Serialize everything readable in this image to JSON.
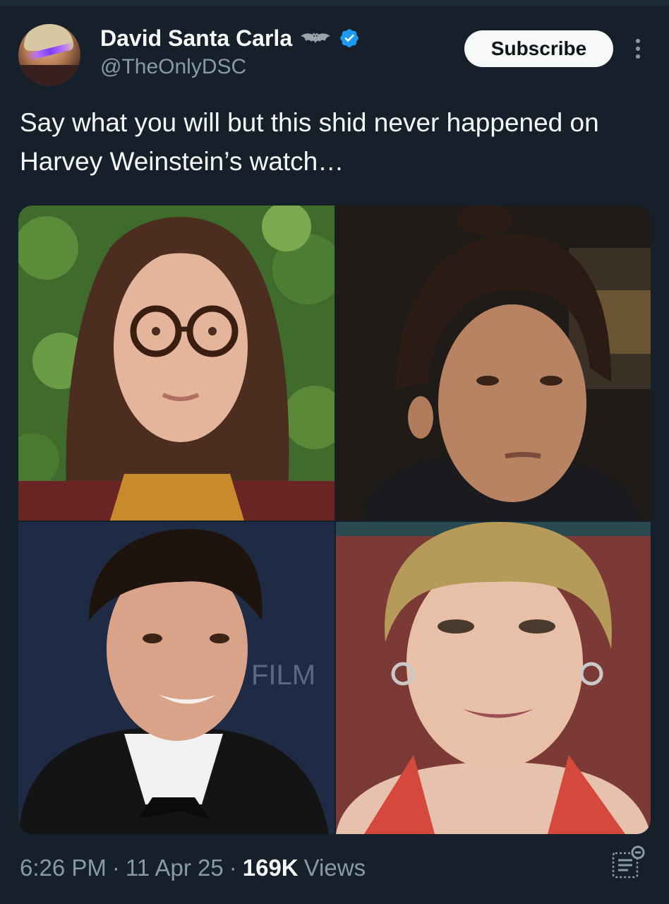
{
  "author": {
    "display_name": "David Santa Carla",
    "handle": "@TheOnlyDSC",
    "badge_icon": "bat-icon",
    "verified_icon": "verified-badge-icon",
    "verified_color": "#1d9bf0"
  },
  "header": {
    "subscribe_label": "Subscribe",
    "more_icon": "more-vertical-icon"
  },
  "tweet": {
    "text": "Say what you will but this shid never happened on Harvey Weinstein’s watch…"
  },
  "media": {
    "photos": [
      {
        "icon": "portrait-photo"
      },
      {
        "icon": "portrait-photo"
      },
      {
        "icon": "portrait-photo",
        "backdrop_text": "FILM"
      },
      {
        "icon": "portrait-photo"
      }
    ]
  },
  "footer": {
    "time": "6:26 PM",
    "date": "11 Apr 25",
    "views_count": "169K",
    "views_label": "Views",
    "separator": "·",
    "analytics_icon": "analytics-icon"
  },
  "colors": {
    "background": "#15202b",
    "text_primary": "#f7f9f9",
    "text_secondary": "#8b98a5",
    "accent": "#1d9bf0"
  }
}
